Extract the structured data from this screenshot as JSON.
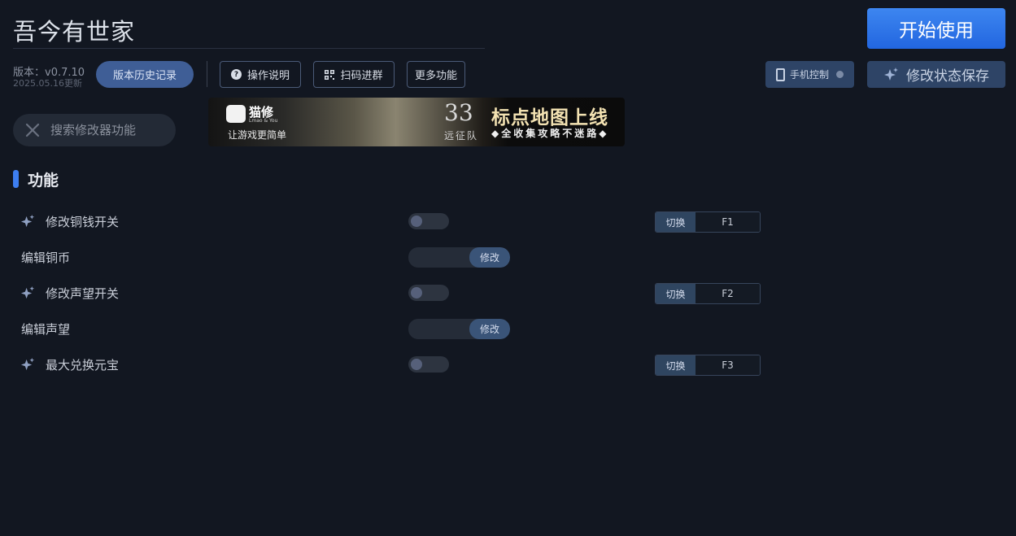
{
  "header": {
    "title": "吾今有世家",
    "start_label": "开始使用",
    "version_label": "版本：v0.7.10",
    "version_date": "2025.05.16更新",
    "history_label": "版本历史记录"
  },
  "toolbar": {
    "instructions_label": "操作说明",
    "scan_label": "扫码进群",
    "more_label": "更多功能",
    "phone_label": "手机控制",
    "save_state_label": "修改状态保存"
  },
  "search": {
    "placeholder": "搜索修改器功能"
  },
  "banner": {
    "brand": "猫修",
    "brand_sub": "Lmao & You",
    "slogan": "让游戏更简单",
    "num": "33",
    "squad": "远征队",
    "headline": "标点地图上线",
    "subline": "◆全收集攻略不迷路◆"
  },
  "section": {
    "title": "功能"
  },
  "features": [
    {
      "label": "修改铜钱开关",
      "toggle_on": false,
      "switch_label": "切换",
      "key": "F1"
    },
    {
      "label": "编辑铜币",
      "edit_label": "修改"
    },
    {
      "label": "修改声望开关",
      "toggle_on": false,
      "switch_label": "切换",
      "key": "F2"
    },
    {
      "label": "编辑声望",
      "edit_label": "修改"
    },
    {
      "label": "最大兑换元宝",
      "toggle_on": false,
      "switch_label": "切换",
      "key": "F3"
    }
  ],
  "colors": {
    "background": "#121721",
    "accent": "#3d7ef0",
    "primary_button": "#2a6fe6"
  }
}
